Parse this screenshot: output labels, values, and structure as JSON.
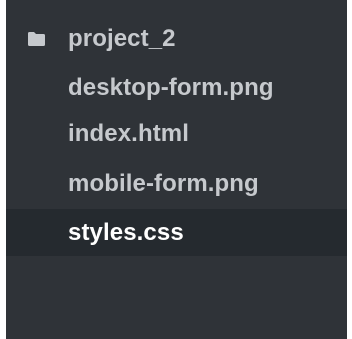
{
  "file_tree": {
    "folder": {
      "name": "project_2",
      "icon": "folder-icon"
    },
    "files": [
      {
        "name": "desktop-form.png"
      },
      {
        "name": "index.html"
      },
      {
        "name": "mobile-form.png"
      },
      {
        "name": "styles.css",
        "selected": true
      }
    ]
  },
  "colors": {
    "panel_bg": "#2f3338",
    "selected_bg": "#252a2f",
    "text": "#c6c9cd",
    "selected_text": "#ffffff"
  }
}
